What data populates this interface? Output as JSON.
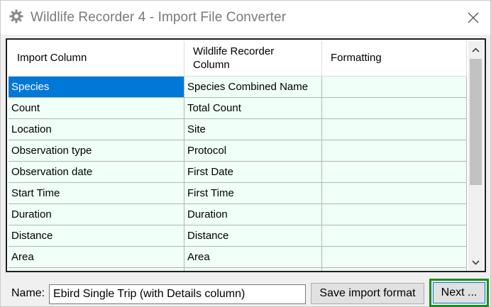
{
  "window": {
    "title": "Wildlife Recorder 4 - Import File Converter",
    "icons": {
      "app": "gear-icon",
      "close": "close-icon"
    }
  },
  "grid": {
    "headers": [
      {
        "line1": "Import Column",
        "line2": ""
      },
      {
        "line1": "Wildlife Recorder",
        "line2": "Column"
      },
      {
        "line1": "Formatting",
        "line2": ""
      }
    ],
    "rows": [
      {
        "import": "Species",
        "wr": "Species Combined Name",
        "fmt": ""
      },
      {
        "import": "Count",
        "wr": "Total Count",
        "fmt": ""
      },
      {
        "import": "Location",
        "wr": "Site",
        "fmt": ""
      },
      {
        "import": "Observation type",
        "wr": "Protocol",
        "fmt": ""
      },
      {
        "import": "Observation date",
        "wr": "First Date",
        "fmt": ""
      },
      {
        "import": "Start Time",
        "wr": "First Time",
        "fmt": ""
      },
      {
        "import": "Duration",
        "wr": "Duration",
        "fmt": ""
      },
      {
        "import": "Distance",
        "wr": "Distance",
        "fmt": ""
      },
      {
        "import": "Area",
        "wr": "Area",
        "fmt": ""
      },
      {
        "import": "",
        "wr": "",
        "fmt": ""
      }
    ],
    "selected_row": 0
  },
  "footer": {
    "name_label": "Name:",
    "name_value": "Ebird Single Trip (with Details column)",
    "save_label": "Save import format",
    "next_label": "Next ..."
  },
  "colors": {
    "selection": "#0078d7",
    "cell_background": "#f0fff7",
    "highlight_outline": "#1e8c1e"
  }
}
